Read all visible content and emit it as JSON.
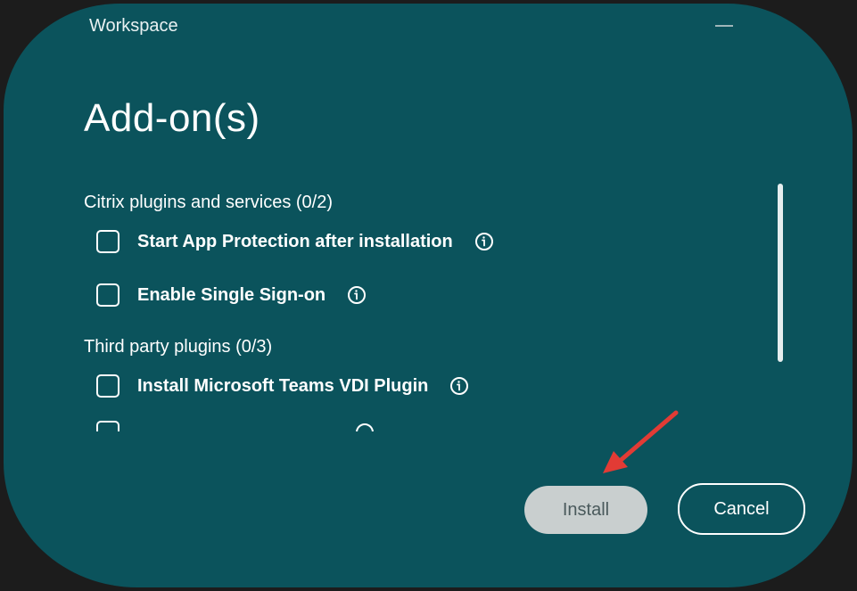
{
  "window": {
    "title": "Workspace",
    "heading": "Add-on(s)"
  },
  "groups": [
    {
      "title": "Citrix plugins and services (0/2)",
      "options": [
        {
          "label": "Start App Protection after installation",
          "checked": false
        },
        {
          "label": "Enable Single Sign-on",
          "checked": false
        }
      ]
    },
    {
      "title": "Third party plugins (0/3)",
      "options": [
        {
          "label": "Install Microsoft Teams VDI Plugin",
          "checked": false
        }
      ]
    }
  ],
  "buttons": {
    "install_label": "Install",
    "cancel_label": "Cancel"
  },
  "colors": {
    "window_background": "#0b535c",
    "install_button": "#c9cfcf",
    "annotation_arrow": "#e23b35"
  },
  "icons": {
    "info": "info-circle-icon",
    "minimize": "minimize-icon",
    "arrow": "annotation-arrow-icon"
  }
}
